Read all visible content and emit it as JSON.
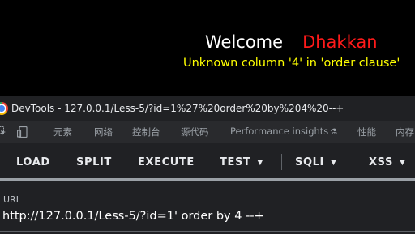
{
  "page": {
    "welcome_text": "Welcome",
    "name_text": "Dhakkan",
    "error_message": "Unknown column '4' in 'order clause'"
  },
  "devtools": {
    "title": "DevTools - 127.0.0.1/Less-5/?id=1%27%20order%20by%204%20--+",
    "tabs": [
      {
        "label": "元素"
      },
      {
        "label": "网络"
      },
      {
        "label": "控制台"
      },
      {
        "label": "源代码"
      },
      {
        "label": "Performance insights"
      },
      {
        "label": "性能"
      },
      {
        "label": "内存"
      }
    ]
  },
  "hackbar": {
    "buttons": {
      "load": "LOAD",
      "split": "SPLIT",
      "execute": "EXECUTE",
      "test": "TEST",
      "sqli": "SQLI",
      "xss": "XSS"
    },
    "url_label": "URL",
    "url_value": "http://127.0.0.1/Less-5/?id=1' order by 4 --+"
  },
  "colors": {
    "welcome": "#ffffff",
    "name": "#ff1a1a",
    "error": "#ffff00",
    "devtools_bg": "#202124"
  },
  "icons": [
    "chrome-logo-icon",
    "element-select-icon",
    "device-toolbar-icon",
    "flask-icon",
    "chevron-down-icon"
  ]
}
